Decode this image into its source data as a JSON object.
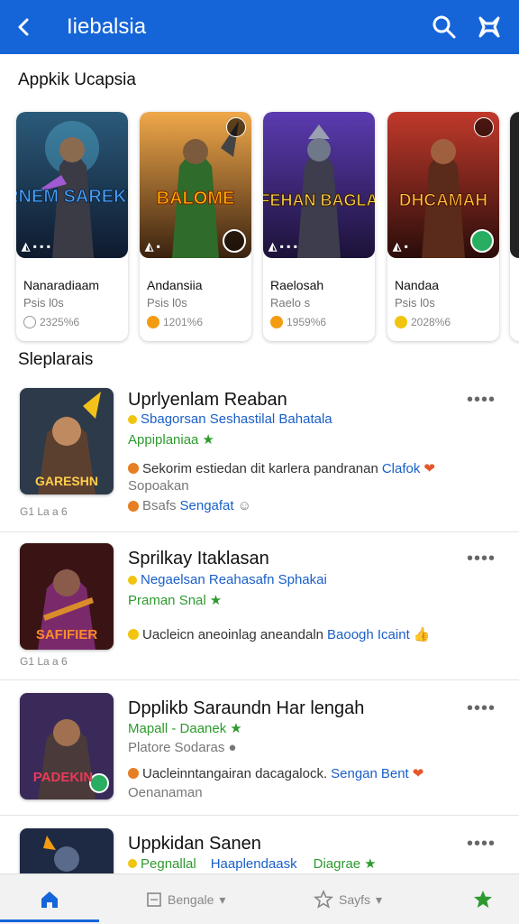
{
  "header": {
    "title": "Iiebalsia"
  },
  "section1": {
    "title": "Appkik Ucapsia"
  },
  "featured": [
    {
      "art_text": "NARNEM SAREKUEN",
      "name": "Nanaradiaam",
      "meta": "Psis l0s",
      "stat": "2325%6",
      "dot_color": "#9a9a9a"
    },
    {
      "art_text": "BALOME",
      "name": "Andansiia",
      "meta": "Psis l0s",
      "stat": "1201%6",
      "dot_color": "#f39c12"
    },
    {
      "art_text": "FEHAN BAGLA",
      "name": "Raelosah",
      "meta": "Raelo s",
      "stat": "1959%6",
      "dot_color": "#f39c12"
    },
    {
      "art_text": "DHCAMAH",
      "name": "Nandaa",
      "meta": "Psis l0s",
      "stat": "2028%6",
      "dot_color": "#f1c40f"
    }
  ],
  "section2": {
    "title": "Sleplarais"
  },
  "list": [
    {
      "name": "Uprlyenlam Reaban",
      "art_text": "GARESHN",
      "line1": "Sbagorsan Seshastilal Bahatala",
      "line2": "Appiplaniaa",
      "line3a": "Sekorim estiedan dit karlera pandranan",
      "line3b": "Clafok",
      "line4": "Sopoakan",
      "line5a": "Bsafs",
      "line5b": "Sengafat",
      "tag": "G1 La a 6"
    },
    {
      "name": "Sprilkay Itaklasan",
      "art_text": "SAFIFIER",
      "line1": "Negaelsan Reahasafn Sphakai",
      "line2": "Praman Snal",
      "line3a": "Uacleicn aneoinlag aneandaln",
      "line3b": "Baoogh Icaint",
      "tag": "G1 La a 6"
    },
    {
      "name": "Dpplikb Saraundn Har lengah",
      "art_text": "PADEKIN",
      "line1": "Mapall - Daanek",
      "line2a": "Platore",
      "line2b": "Sodaras",
      "line3a": "Uacleinntangairan dacagalock.",
      "line3b": "Sengan",
      "line3c": "Bent",
      "line4": "Oenanaman"
    },
    {
      "name": "Uppkidan Sanen",
      "line1a": "Pegnallal",
      "line1b": "Haaplendaask",
      "line1c": "Diagrae"
    }
  ],
  "nav": {
    "item2": "Bengale",
    "item3": "Sayfs"
  }
}
